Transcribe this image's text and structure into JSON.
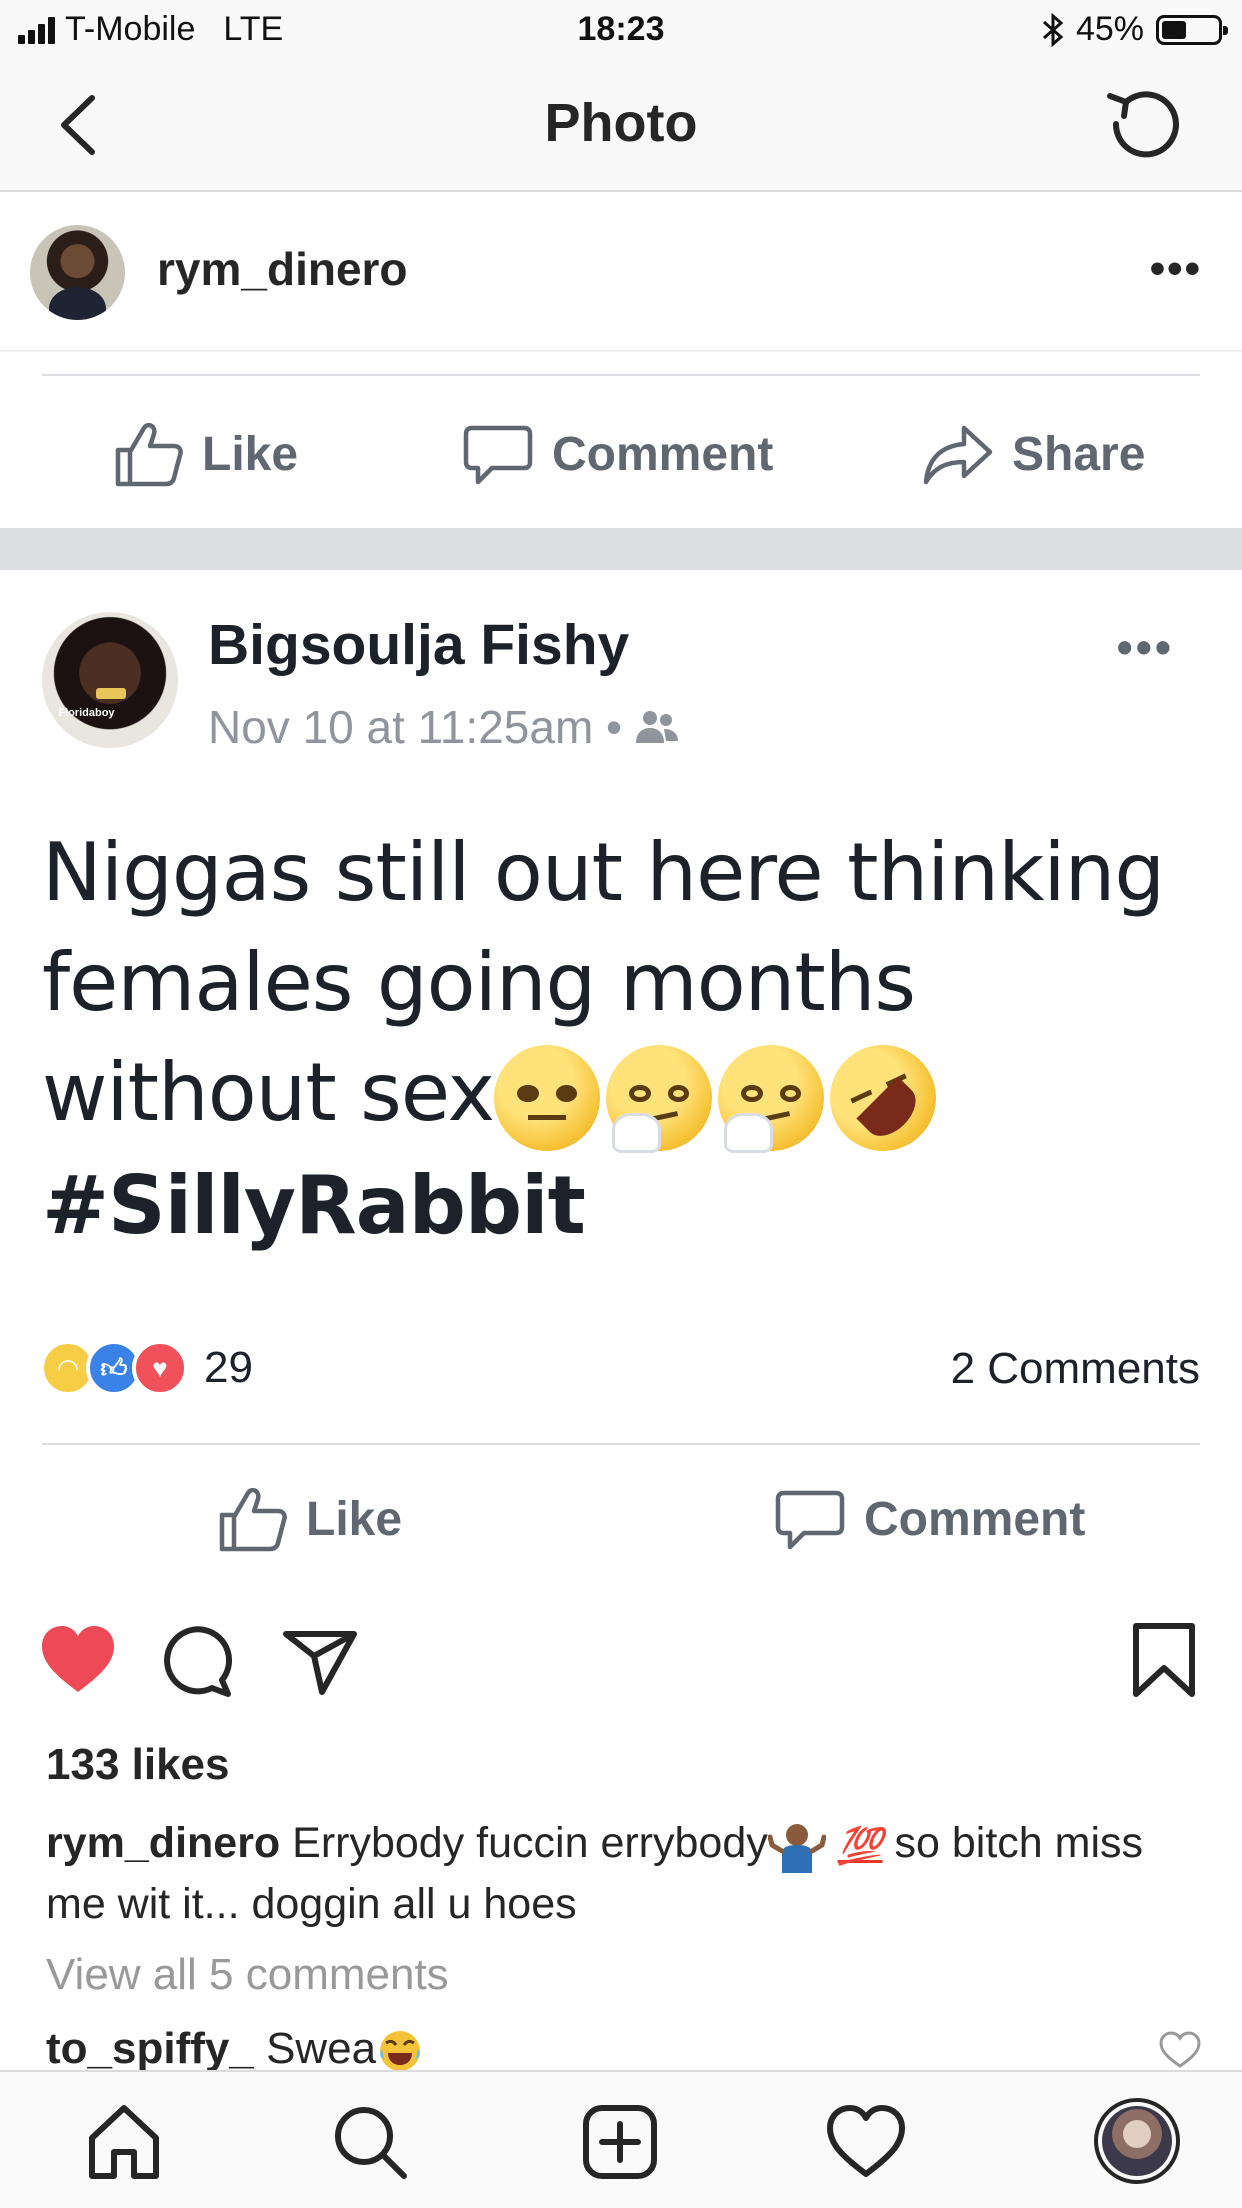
{
  "status_bar": {
    "carrier": "T-Mobile",
    "network": "LTE",
    "time": "18:23",
    "battery": "45%",
    "battery_level": 0.45
  },
  "nav": {
    "title": "Photo"
  },
  "post_header": {
    "username": "rym_dinero",
    "more": "•••"
  },
  "screenshot_fb": {
    "actions_top": {
      "like": "Like",
      "comment": "Comment",
      "share": "Share"
    },
    "author": "Bigsoulja Fishy",
    "meta": "Nov 10 at 11:25am •",
    "avatar_tag": "Floridaboy",
    "more": "•••",
    "text_lines": {
      "line1": "Niggas still out here thinking",
      "line2": "females going months",
      "line3": "without sex",
      "hashtag": "#SillyRabbit"
    },
    "reaction_count": "29",
    "comments_count": "2 Comments",
    "actions_bottom": {
      "like": "Like",
      "comment": "Comment"
    }
  },
  "post": {
    "likes": "133 likes",
    "caption_user": "rym_dinero",
    "caption_part1": "Errybody fuccin errybody",
    "caption_emoji_100": "💯",
    "caption_part2": "so bitch miss me wit it... doggin all u hoes",
    "view_all": "View all 5 comments",
    "comment_user": "to_spiffy_",
    "comment_text": "Swea",
    "liked": true
  },
  "colors": {
    "heart_red": "#ed4956",
    "fb_gray": "#606770",
    "fb_band": "#dddfe2",
    "text": "#262626"
  },
  "icons": {
    "back": "chevron-left-icon",
    "refresh": "refresh-icon",
    "like": "heart-icon",
    "comment": "comment-bubble-icon",
    "share": "paper-plane-icon",
    "save": "bookmark-icon",
    "tabs": [
      "home-icon",
      "search-icon",
      "add-icon",
      "activity-heart-icon",
      "profile-avatar"
    ]
  }
}
